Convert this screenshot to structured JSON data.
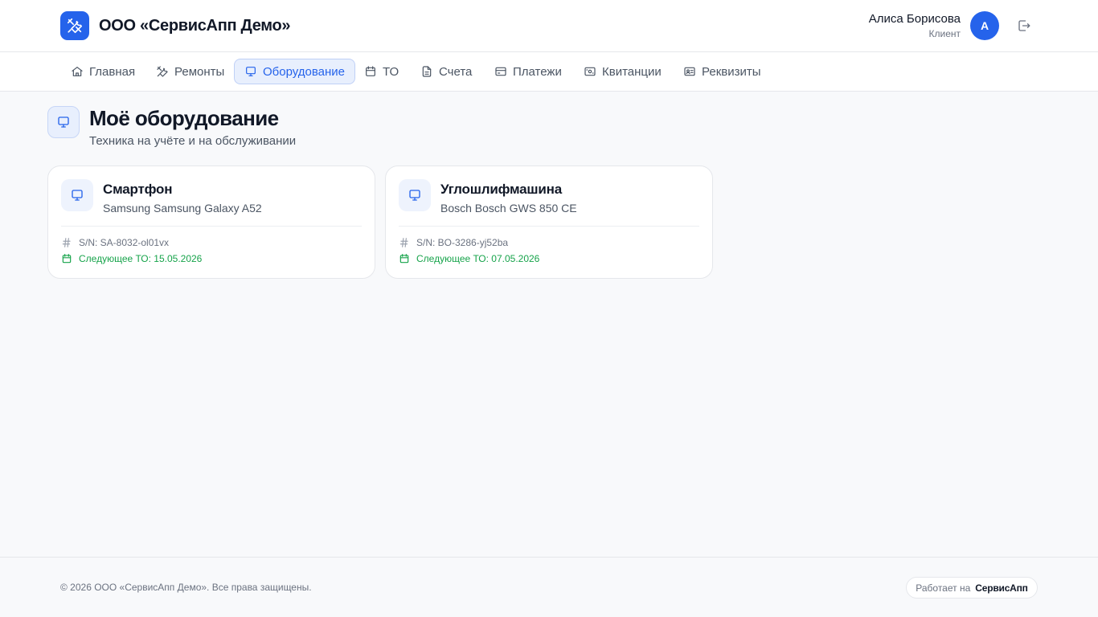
{
  "header": {
    "app_title": "ООО «СервисАпп Демо»",
    "logo_icon": "tools-icon",
    "user_name": "Алиса Борисова",
    "user_role": "Клиент",
    "avatar_letter": "А",
    "logout_icon": "logout-icon"
  },
  "nav": {
    "items": [
      {
        "label": "Главная",
        "icon": "home-icon"
      },
      {
        "label": "Ремонты",
        "icon": "tools-icon"
      },
      {
        "label": "Оборудование",
        "icon": "monitor-icon",
        "active": true
      },
      {
        "label": "ТО",
        "icon": "calendar-icon"
      },
      {
        "label": "Счета",
        "icon": "document-icon"
      },
      {
        "label": "Платежи",
        "icon": "credit-card-icon"
      },
      {
        "label": "Квитанции",
        "icon": "receipt-icon"
      },
      {
        "label": "Реквизиты",
        "icon": "id-card-icon"
      }
    ]
  },
  "page": {
    "icon": "monitor-icon",
    "title": "Моё оборудование",
    "subtitle": "Техника на учёте и на обслуживании"
  },
  "equipment": [
    {
      "title": "Смартфон",
      "model": "Samsung Samsung Galaxy A52",
      "serial": "S/N: SA-8032-ol01vx",
      "next_service": "Следующее ТО: 15.05.2026"
    },
    {
      "title": "Углошлифмашина",
      "model": "Bosch Bosch GWS 850 CE",
      "serial": "S/N: BO-3286-yj52ba",
      "next_service": "Следующее ТО: 07.05.2026"
    }
  ],
  "footer": {
    "copyright": "© 2026 ООО «СервисАпп Демо». Все права защищены.",
    "powered_prefix": "Работает на",
    "powered_brand": "СервисАпп"
  },
  "colors": {
    "accent": "#2563eb",
    "accent_light": "#e8effd",
    "success": "#16a34a",
    "text": "#111827",
    "muted": "#6b7280",
    "background": "#f8f9fb"
  }
}
